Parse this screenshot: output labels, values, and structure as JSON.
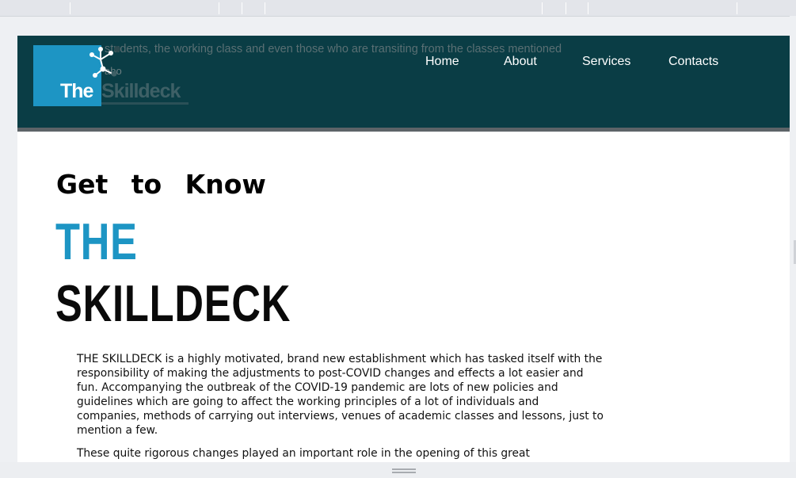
{
  "header": {
    "overlay_text": "students, the working class and even those who are transiting from the classes mentioned",
    "overlay_small": "abo"
  },
  "logo": {
    "word_the": "The",
    "word_skill": "Skilldeck",
    "brand_color": "#1d95c4"
  },
  "nav": {
    "items": [
      {
        "label": "Home"
      },
      {
        "label": "About"
      },
      {
        "label": "Services"
      },
      {
        "label": "Contacts"
      }
    ]
  },
  "hero": {
    "kicker": "Get to Know",
    "brand_the": "THE",
    "brand_name": "SKILLDECK"
  },
  "content": {
    "paragraph1": "THE SKILLDECK is a highly motivated, brand new establishment which has tasked itself with the responsibility of making the adjustments to post-COVID changes and effects a lot easier and fun. Accompanying the outbreak of the COVID-19 pandemic are lots of new policies and guidelines which are going to affect the working principles of a lot of individuals and companies, methods of carrying out interviews, venues of academic classes and lessons, just to mention a few.",
    "paragraph2": "These quite rigorous changes played an important role in the opening of this great establishment, one that promises to make life and work a lot easier and more meaningful for"
  },
  "colors": {
    "header_bg": "#0a3d45",
    "accent": "#1d95c4",
    "nav_text": "#ffffff"
  }
}
